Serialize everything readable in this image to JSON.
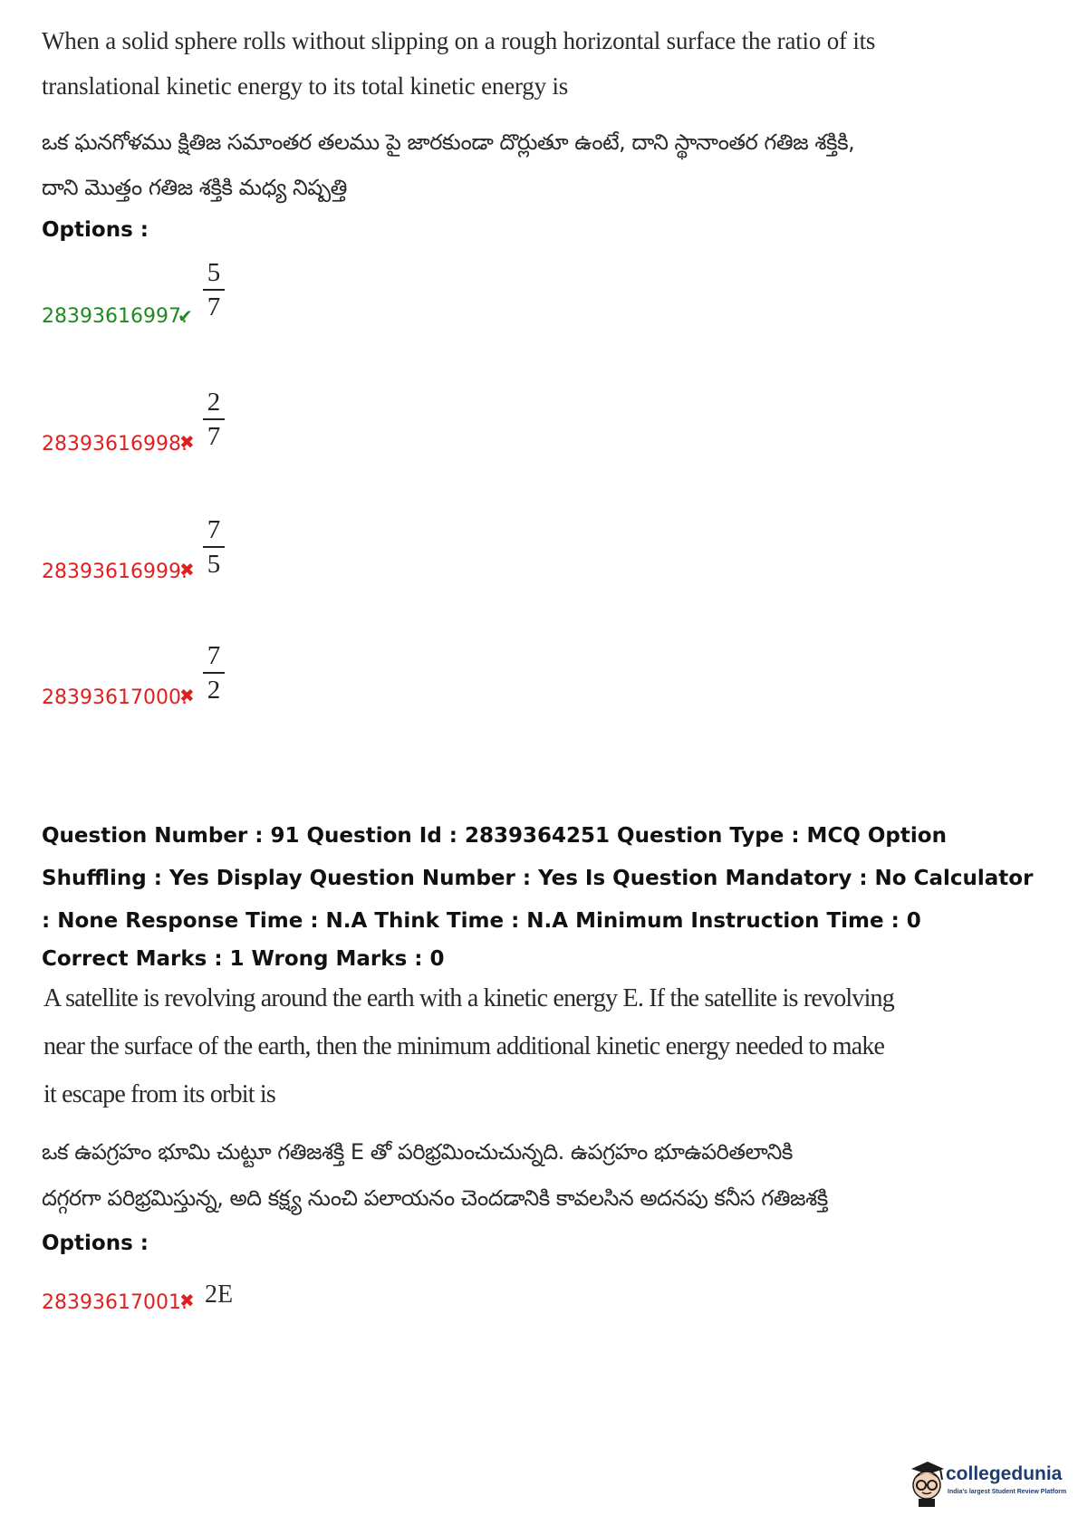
{
  "q1": {
    "text_en": [
      "When a solid sphere rolls without slipping on a rough horizontal surface the ratio of its",
      "translational kinetic energy to its total kinetic energy is"
    ],
    "text_te": [
      "ఒక ఘనగోళము క్షితిజ సమాంతర తలము పై జారకుండా దొర్లుతూ ఉంటే, దాని స్థానాంతర గతిజ శక్తికి,",
      "దాని మొత్తం గతిజ శక్తికి మధ్య నిష్పత్తి"
    ],
    "options_label": "Options :",
    "options": [
      {
        "id": "28393616997.",
        "status": "correct",
        "numerator": "5",
        "denominator": "7"
      },
      {
        "id": "28393616998.",
        "status": "wrong",
        "numerator": "2",
        "denominator": "7"
      },
      {
        "id": "28393616999.",
        "status": "wrong",
        "numerator": "7",
        "denominator": "5"
      },
      {
        "id": "28393617000.",
        "status": "wrong",
        "numerator": "7",
        "denominator": "2"
      }
    ]
  },
  "q2": {
    "meta": "Question Number : 91 Question Id : 2839364251 Question Type : MCQ Option Shuffling : Yes Display Question Number : Yes Is Question Mandatory : No Calculator : None Response Time : N.A Think Time : N.A Minimum Instruction Time : 0",
    "marks": "Correct Marks : 1 Wrong Marks : 0",
    "text_en": [
      "A satellite is revolving around the earth with a kinetic energy E. If the satellite is revolving",
      "near the surface of the earth, then the minimum additional kinetic energy needed to make",
      "it escape from its orbit is"
    ],
    "text_te": [
      "ఒక ఉపగ్రహం భూమి చుట్టూ గతిజశక్తి E తో పరిభ్రమించుచున్నది. ఉపగ్రహం భూఉపరితలానికి",
      "దగ్గరగా పరిభ్రమిస్తున్న, అది కక్ష్య నుంచి పలాయనం చెందడానికి కావలసిన అదనపు కనీస గతిజశక్తి"
    ],
    "options_label": "Options :",
    "options": [
      {
        "id": "28393617001.",
        "status": "wrong",
        "value": "2E"
      }
    ]
  },
  "marks_icons": {
    "correct": "check-icon",
    "wrong": "cross-icon"
  },
  "colors": {
    "correct": "#1f8a1f",
    "wrong": "#e02020"
  },
  "logo": {
    "name": "collegedunia",
    "tagline": "India's largest Student Review Platform"
  }
}
